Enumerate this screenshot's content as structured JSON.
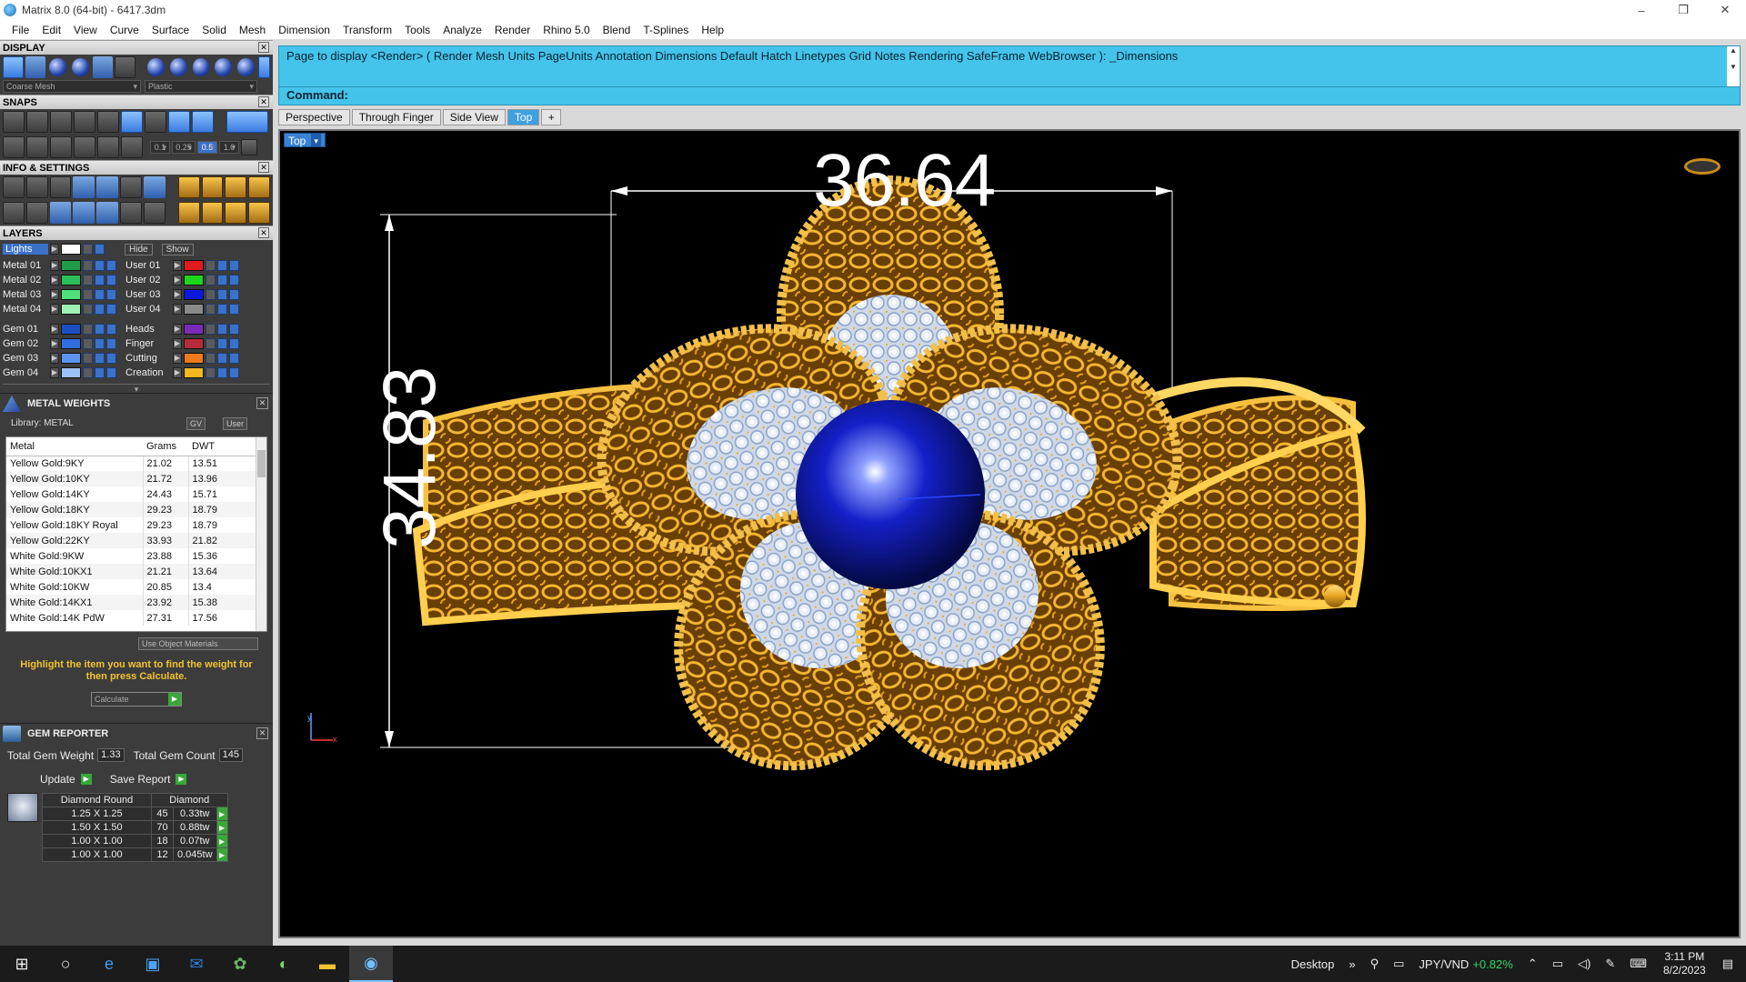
{
  "window": {
    "title": "Matrix 8.0 (64-bit) - 6417.3dm",
    "minimize": "–",
    "maximize": "❐",
    "close": "✕"
  },
  "menu": [
    "File",
    "Edit",
    "View",
    "Curve",
    "Surface",
    "Solid",
    "Mesh",
    "Dimension",
    "Transform",
    "Tools",
    "Analyze",
    "Render",
    "Rhino 5.0",
    "Blend",
    "T-Splines",
    "Help"
  ],
  "left_panel": {
    "display": {
      "title": "DISPLAY",
      "combo_left": "Coarse Mesh",
      "combo_right": "Plastic"
    },
    "snaps": {
      "title": "SNAPS",
      "values": [
        "0.1",
        "0.25",
        "0.5",
        "1.0"
      ]
    },
    "info": {
      "title": "INFO & SETTINGS"
    },
    "layers": {
      "title": "LAYERS",
      "lights_label": "Lights",
      "hide_label": "Hide",
      "show_label": "Show",
      "left": [
        {
          "name": "Metal 01",
          "color": "#1f9c48"
        },
        {
          "name": "Metal 02",
          "color": "#2bbf5a"
        },
        {
          "name": "Metal 03",
          "color": "#4fe07a"
        },
        {
          "name": "Metal 04",
          "color": "#9ff2b5"
        },
        {
          "name": "Gem 01",
          "color": "#1a4fbf"
        },
        {
          "name": "Gem 02",
          "color": "#2f6ee0"
        },
        {
          "name": "Gem 03",
          "color": "#5b95f0"
        },
        {
          "name": "Gem 04",
          "color": "#9cc1f7"
        }
      ],
      "right": [
        {
          "name": "User 01",
          "color": "#e01b1b"
        },
        {
          "name": "User 02",
          "color": "#1bd61b"
        },
        {
          "name": "User 03",
          "color": "#0b18e0"
        },
        {
          "name": "User 04",
          "color": "#8a8a8a"
        },
        {
          "name": "Heads",
          "color": "#7a2bb8"
        },
        {
          "name": "Finger",
          "color": "#b82b3a"
        },
        {
          "name": "Cutting",
          "color": "#f07a1a"
        },
        {
          "name": "Creation",
          "color": "#f2b81f"
        }
      ]
    },
    "metal_weights": {
      "title": "METAL WEIGHTS",
      "library": "Library: METAL",
      "tag_gv": "GV",
      "tag_user": "User",
      "columns": [
        "Metal",
        "Grams",
        "DWT"
      ],
      "rows": [
        [
          "Yellow Gold:9KY",
          "21.02",
          "13.51"
        ],
        [
          "Yellow Gold:10KY",
          "21.72",
          "13.96"
        ],
        [
          "Yellow Gold:14KY",
          "24.43",
          "15.71"
        ],
        [
          "Yellow Gold:18KY",
          "29.23",
          "18.79"
        ],
        [
          "Yellow Gold:18KY Royal",
          "29.23",
          "18.79"
        ],
        [
          "Yellow Gold:22KY",
          "33.93",
          "21.82"
        ],
        [
          "White Gold:9KW",
          "23.88",
          "15.36"
        ],
        [
          "White Gold:10KX1",
          "21.21",
          "13.64"
        ],
        [
          "White Gold:10KW",
          "20.85",
          "13.4"
        ],
        [
          "White Gold:14KX1",
          "23.92",
          "15.38"
        ],
        [
          "White Gold:14K PdW",
          "27.31",
          "17.56"
        ]
      ],
      "use_object_materials": "Use Object Materials",
      "hint": "Highlight the item you want to find the weight for then press Calculate.",
      "calculate": "Calculate"
    },
    "gem_reporter": {
      "title": "GEM REPORTER",
      "total_weight_label": "Total Gem Weight",
      "total_weight": "1.33",
      "total_count_label": "Total Gem Count",
      "total_count": "145",
      "update": "Update",
      "save_report": "Save Report",
      "columns": [
        "Diamond Round",
        "Diamond"
      ],
      "rows": [
        [
          "1.25 X 1.25",
          "45",
          "0.33tw"
        ],
        [
          "1.50 X 1.50",
          "70",
          "0.88tw"
        ],
        [
          "1.00 X 1.00",
          "18",
          "0.07tw"
        ],
        [
          "1.00 X 1.00",
          "12",
          "0.045tw"
        ]
      ]
    }
  },
  "command": {
    "history": "Page to display <Render> ( Render  Mesh  Units  PageUnits  Annotation  Dimensions  Default  Hatch  Linetypes  Grid  Notes  Rendering  SafeFrame  WebBrowser ): _Dimensions",
    "prompt": "Command:"
  },
  "viewport_tabs": [
    "Perspective",
    "Through Finger",
    "Side View",
    "Top"
  ],
  "active_tab": "Top",
  "add_tab": "+",
  "viewport": {
    "label": "Top",
    "dim_width": "36.64",
    "dim_height": "34.83",
    "axis_y": "y",
    "axis_x": "x"
  },
  "taskbar": {
    "desktop": "Desktop",
    "currency": "JPY/VND",
    "change": "+0.82%",
    "time": "3:11 PM",
    "date": "8/2/2023"
  }
}
